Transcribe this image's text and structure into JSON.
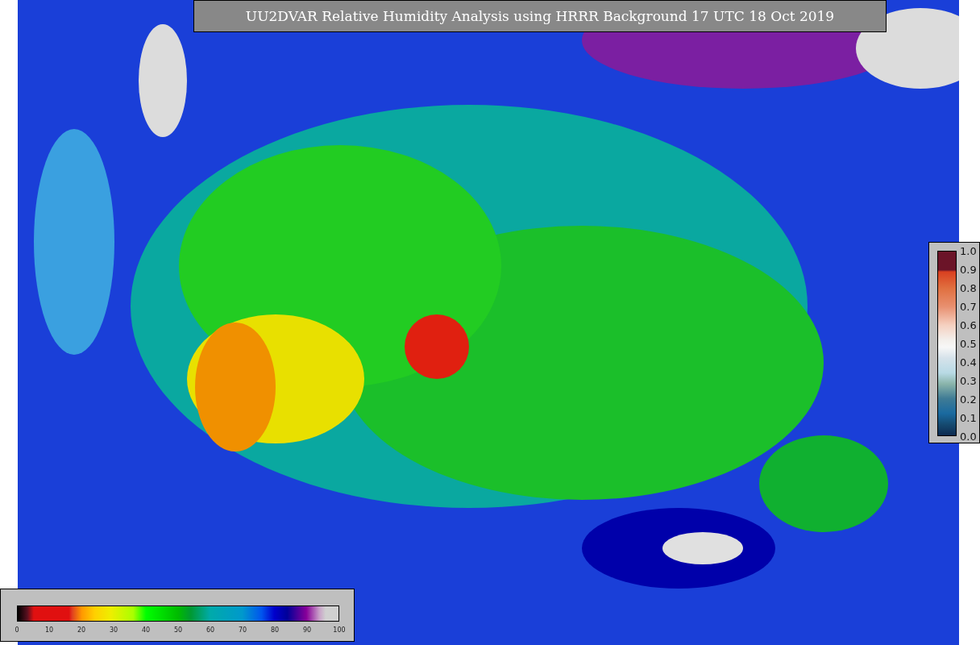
{
  "title": "UU2DVAR Relative Humidity Analysis using HRRR Background 17 UTC 18 Oct 2019",
  "humidity_colorbar": {
    "ticks": [
      "0",
      "10",
      "20",
      "30",
      "40",
      "50",
      "60",
      "70",
      "80",
      "90",
      "100"
    ]
  },
  "observation_colorbar": {
    "ticks": [
      "1.0",
      "0.9",
      "0.8",
      "0.7",
      "0.6",
      "0.5",
      "0.4",
      "0.3",
      "0.2",
      "0.1",
      "0.0"
    ]
  }
}
